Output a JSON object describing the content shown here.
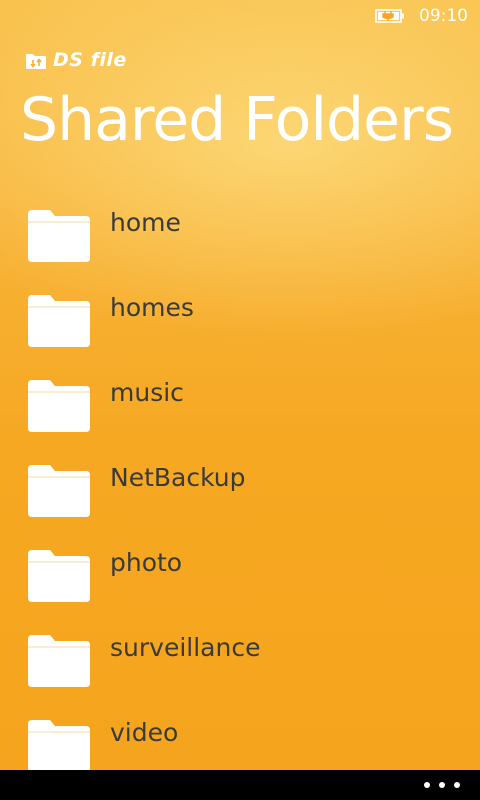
{
  "status_bar": {
    "time": "09:10",
    "battery_icon": "battery-charging-icon"
  },
  "header": {
    "app_name": "DS file",
    "app_icon": "folder-sync-icon",
    "title": "Shared Folders"
  },
  "folders": [
    {
      "name": "home",
      "icon": "folder-icon"
    },
    {
      "name": "homes",
      "icon": "folder-icon"
    },
    {
      "name": "music",
      "icon": "folder-icon"
    },
    {
      "name": "NetBackup",
      "icon": "folder-icon"
    },
    {
      "name": "photo",
      "icon": "folder-icon"
    },
    {
      "name": "surveillance",
      "icon": "folder-icon"
    },
    {
      "name": "video",
      "icon": "folder-icon"
    }
  ],
  "app_bar": {
    "more_icon": "more-icon"
  },
  "colors": {
    "background": "#f5a623",
    "text_primary": "#ffffff",
    "text_item": "#3a3a3a",
    "app_bar": "#000000"
  }
}
